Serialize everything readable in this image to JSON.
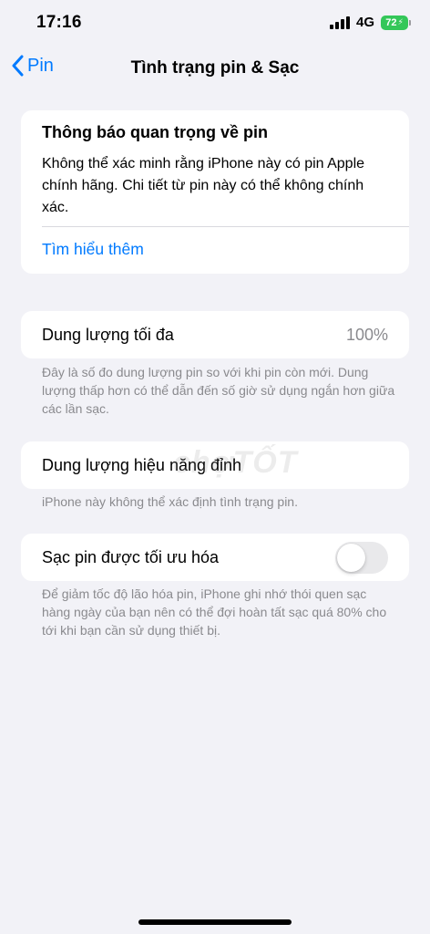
{
  "status_bar": {
    "time": "17:16",
    "network": "4G",
    "battery_percent": "72",
    "battery_color": "#34c759",
    "signal_bars": 4,
    "icons": [
      "signal-icon",
      "battery-icon",
      "bolt-icon"
    ]
  },
  "nav": {
    "back_label": "Pin",
    "title": "Tình trạng pin & Sạc",
    "back_icon": "chevron-left-icon"
  },
  "notice": {
    "title": "Thông báo quan trọng về pin",
    "body": "Không thể xác minh rằng iPhone này có pin Apple chính hãng. Chi tiết từ pin này có thể không chính xác.",
    "link": "Tìm hiểu thêm"
  },
  "max_capacity": {
    "label": "Dung lượng tối đa",
    "value": "100%",
    "footnote": "Đây là số đo dung lượng pin so với khi pin còn mới. Dung lượng thấp hơn có thể dẫn đến số giờ sử dụng ngắn hơn giữa các lần sạc."
  },
  "peak_performance": {
    "label": "Dung lượng hiệu năng đỉnh",
    "footnote": "iPhone này không thể xác định tình trạng pin."
  },
  "optimized_charging": {
    "label": "Sạc pin được tối ưu hóa",
    "enabled": false,
    "footnote": "Để giảm tốc độ lão hóa pin, iPhone ghi nhớ thói quen sạc hàng ngày của bạn nên có thể đợi hoàn tất sạc quá 80% cho tới khi bạn cần sử dụng thiết bị."
  },
  "watermark": "chợTỐT",
  "colors": {
    "accent": "#007aff",
    "background": "#f2f2f7",
    "secondary_text": "#8a8a8e"
  }
}
